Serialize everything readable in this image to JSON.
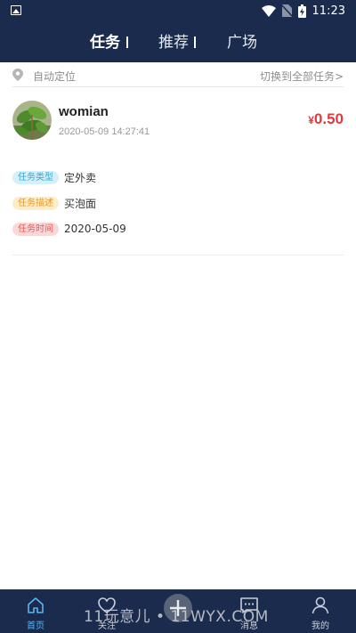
{
  "status_bar": {
    "time": "11:23"
  },
  "top_tabs": [
    {
      "label": "任务",
      "active": true
    },
    {
      "label": "推荐",
      "active": false
    },
    {
      "label": "广场",
      "active": false
    }
  ],
  "location_bar": {
    "location_text": "自动定位",
    "switch_link": "切换到全部任务>"
  },
  "task_card": {
    "username": "womian",
    "timestamp": "2020-05-09 14:27:41",
    "price_symbol": "¥",
    "price_amount": "0.50",
    "rows": [
      {
        "tag": "任务类型",
        "value": "定外卖"
      },
      {
        "tag": "任务描述",
        "value": "买泡面"
      },
      {
        "tag": "任务时间",
        "value": "2020-05-09"
      }
    ]
  },
  "bottom_nav": [
    {
      "label": "首页",
      "icon": "home-icon",
      "active": true
    },
    {
      "label": "关注",
      "icon": "heart-icon",
      "active": false
    },
    {
      "label": "",
      "icon": "add-icon",
      "active": false
    },
    {
      "label": "消息",
      "icon": "message-icon",
      "active": false
    },
    {
      "label": "我的",
      "icon": "user-icon",
      "active": false
    }
  ],
  "watermark": "11玩意儿 • 11WYX.COM",
  "colors": {
    "header_bg": "#1a2b4d",
    "price": "#e4393c",
    "active_nav": "#5bb3f5"
  }
}
